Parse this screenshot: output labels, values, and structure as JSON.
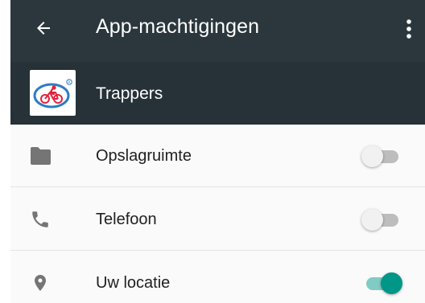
{
  "toolbar": {
    "title": "App-machtigingen",
    "back_icon": "arrow-left-icon",
    "overflow_icon": "more-vert-icon"
  },
  "app": {
    "name": "Trappers",
    "logo_icon": "trappers-logo-icon"
  },
  "permissions": [
    {
      "label": "Opslagruimte",
      "icon": "folder-icon",
      "enabled": false
    },
    {
      "label": "Telefoon",
      "icon": "phone-icon",
      "enabled": false
    },
    {
      "label": "Uw locatie",
      "icon": "location-pin-icon",
      "enabled": true
    }
  ],
  "colors": {
    "toolbar": "#2b373d",
    "app_header": "#263238",
    "accent": "#009688",
    "accent_track": "#80cbc4",
    "logo_red": "#e0243d",
    "logo_blue": "#2b7cc4"
  }
}
